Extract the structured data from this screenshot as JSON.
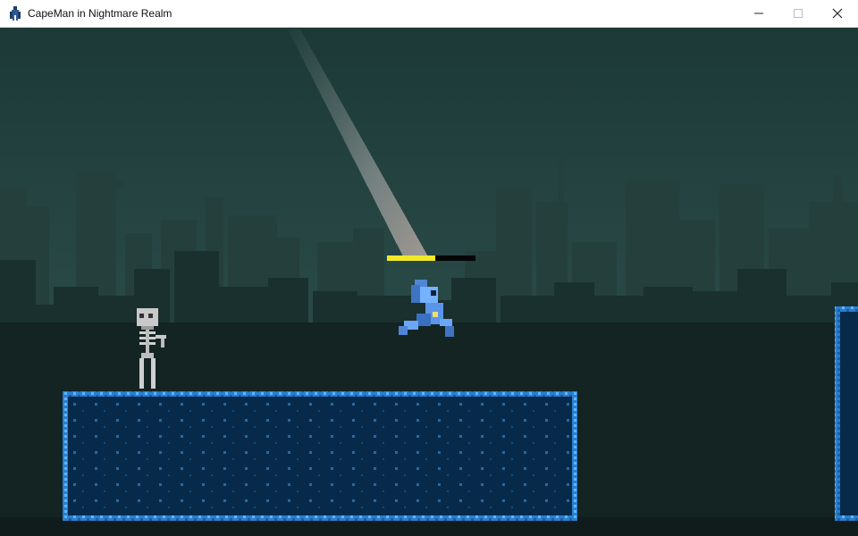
{
  "window": {
    "title": "CapeMan in Nightmare Realm",
    "app_icon": "capeman-icon",
    "controls": [
      "minimize-icon",
      "maximize-icon",
      "close-icon"
    ]
  },
  "game": {
    "player": {
      "name": "CapeMan",
      "health_fraction": 0.55
    },
    "enemies": [
      {
        "type": "skeleton"
      }
    ],
    "colors": {
      "sky": "#1d3b3a",
      "ground": "#132121",
      "platform_fill": "#082a4a",
      "platform_edge": "#2f8fe0",
      "health": "#f2e82b"
    }
  }
}
